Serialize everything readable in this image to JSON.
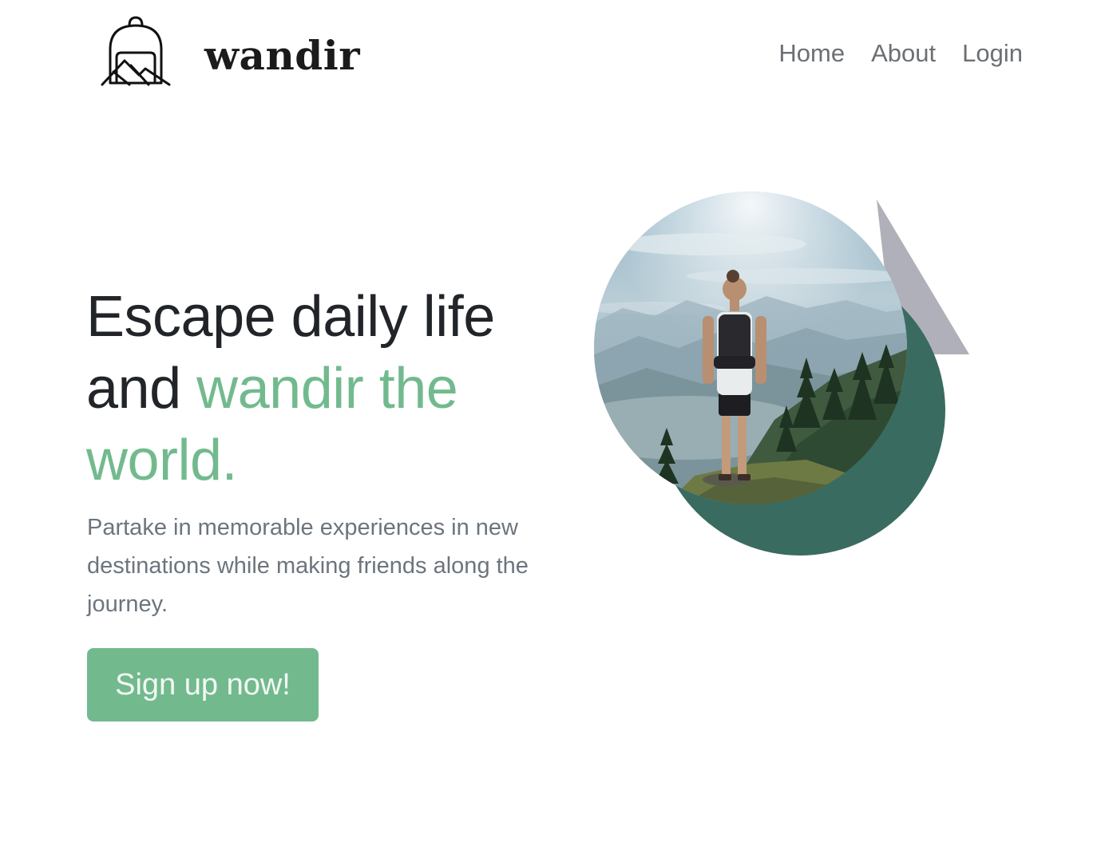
{
  "brand": {
    "name": "wandir"
  },
  "nav": {
    "items": [
      {
        "label": "Home"
      },
      {
        "label": "About"
      },
      {
        "label": "Login"
      }
    ]
  },
  "hero": {
    "title_plain": "Escape daily life and ",
    "title_accent": "wandir the world.",
    "subtitle": "Partake in memorable experiences in new destinations while making friends along the journey.",
    "cta_label": "Sign up now!"
  },
  "colors": {
    "accent": "#72ba8e",
    "dark_green_circle": "#3a6b60",
    "triangle": "#b0b0ba",
    "heading": "#212529",
    "muted": "#6c757d"
  },
  "icons": {
    "logo": "backpack-mountain-icon"
  }
}
